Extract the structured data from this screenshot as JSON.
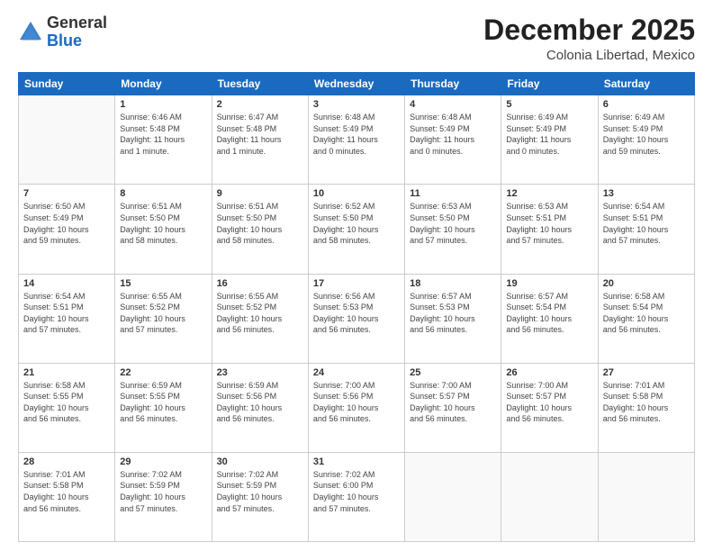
{
  "header": {
    "logo_general": "General",
    "logo_blue": "Blue",
    "month_title": "December 2025",
    "subtitle": "Colonia Libertad, Mexico"
  },
  "weekdays": [
    "Sunday",
    "Monday",
    "Tuesday",
    "Wednesday",
    "Thursday",
    "Friday",
    "Saturday"
  ],
  "weeks": [
    [
      {
        "day": "",
        "info": ""
      },
      {
        "day": "1",
        "info": "Sunrise: 6:46 AM\nSunset: 5:48 PM\nDaylight: 11 hours\nand 1 minute."
      },
      {
        "day": "2",
        "info": "Sunrise: 6:47 AM\nSunset: 5:48 PM\nDaylight: 11 hours\nand 1 minute."
      },
      {
        "day": "3",
        "info": "Sunrise: 6:48 AM\nSunset: 5:49 PM\nDaylight: 11 hours\nand 0 minutes."
      },
      {
        "day": "4",
        "info": "Sunrise: 6:48 AM\nSunset: 5:49 PM\nDaylight: 11 hours\nand 0 minutes."
      },
      {
        "day": "5",
        "info": "Sunrise: 6:49 AM\nSunset: 5:49 PM\nDaylight: 11 hours\nand 0 minutes."
      },
      {
        "day": "6",
        "info": "Sunrise: 6:49 AM\nSunset: 5:49 PM\nDaylight: 10 hours\nand 59 minutes."
      }
    ],
    [
      {
        "day": "7",
        "info": "Sunrise: 6:50 AM\nSunset: 5:49 PM\nDaylight: 10 hours\nand 59 minutes."
      },
      {
        "day": "8",
        "info": "Sunrise: 6:51 AM\nSunset: 5:50 PM\nDaylight: 10 hours\nand 58 minutes."
      },
      {
        "day": "9",
        "info": "Sunrise: 6:51 AM\nSunset: 5:50 PM\nDaylight: 10 hours\nand 58 minutes."
      },
      {
        "day": "10",
        "info": "Sunrise: 6:52 AM\nSunset: 5:50 PM\nDaylight: 10 hours\nand 58 minutes."
      },
      {
        "day": "11",
        "info": "Sunrise: 6:53 AM\nSunset: 5:50 PM\nDaylight: 10 hours\nand 57 minutes."
      },
      {
        "day": "12",
        "info": "Sunrise: 6:53 AM\nSunset: 5:51 PM\nDaylight: 10 hours\nand 57 minutes."
      },
      {
        "day": "13",
        "info": "Sunrise: 6:54 AM\nSunset: 5:51 PM\nDaylight: 10 hours\nand 57 minutes."
      }
    ],
    [
      {
        "day": "14",
        "info": "Sunrise: 6:54 AM\nSunset: 5:51 PM\nDaylight: 10 hours\nand 57 minutes."
      },
      {
        "day": "15",
        "info": "Sunrise: 6:55 AM\nSunset: 5:52 PM\nDaylight: 10 hours\nand 57 minutes."
      },
      {
        "day": "16",
        "info": "Sunrise: 6:55 AM\nSunset: 5:52 PM\nDaylight: 10 hours\nand 56 minutes."
      },
      {
        "day": "17",
        "info": "Sunrise: 6:56 AM\nSunset: 5:53 PM\nDaylight: 10 hours\nand 56 minutes."
      },
      {
        "day": "18",
        "info": "Sunrise: 6:57 AM\nSunset: 5:53 PM\nDaylight: 10 hours\nand 56 minutes."
      },
      {
        "day": "19",
        "info": "Sunrise: 6:57 AM\nSunset: 5:54 PM\nDaylight: 10 hours\nand 56 minutes."
      },
      {
        "day": "20",
        "info": "Sunrise: 6:58 AM\nSunset: 5:54 PM\nDaylight: 10 hours\nand 56 minutes."
      }
    ],
    [
      {
        "day": "21",
        "info": "Sunrise: 6:58 AM\nSunset: 5:55 PM\nDaylight: 10 hours\nand 56 minutes."
      },
      {
        "day": "22",
        "info": "Sunrise: 6:59 AM\nSunset: 5:55 PM\nDaylight: 10 hours\nand 56 minutes."
      },
      {
        "day": "23",
        "info": "Sunrise: 6:59 AM\nSunset: 5:56 PM\nDaylight: 10 hours\nand 56 minutes."
      },
      {
        "day": "24",
        "info": "Sunrise: 7:00 AM\nSunset: 5:56 PM\nDaylight: 10 hours\nand 56 minutes."
      },
      {
        "day": "25",
        "info": "Sunrise: 7:00 AM\nSunset: 5:57 PM\nDaylight: 10 hours\nand 56 minutes."
      },
      {
        "day": "26",
        "info": "Sunrise: 7:00 AM\nSunset: 5:57 PM\nDaylight: 10 hours\nand 56 minutes."
      },
      {
        "day": "27",
        "info": "Sunrise: 7:01 AM\nSunset: 5:58 PM\nDaylight: 10 hours\nand 56 minutes."
      }
    ],
    [
      {
        "day": "28",
        "info": "Sunrise: 7:01 AM\nSunset: 5:58 PM\nDaylight: 10 hours\nand 56 minutes."
      },
      {
        "day": "29",
        "info": "Sunrise: 7:02 AM\nSunset: 5:59 PM\nDaylight: 10 hours\nand 57 minutes."
      },
      {
        "day": "30",
        "info": "Sunrise: 7:02 AM\nSunset: 5:59 PM\nDaylight: 10 hours\nand 57 minutes."
      },
      {
        "day": "31",
        "info": "Sunrise: 7:02 AM\nSunset: 6:00 PM\nDaylight: 10 hours\nand 57 minutes."
      },
      {
        "day": "",
        "info": ""
      },
      {
        "day": "",
        "info": ""
      },
      {
        "day": "",
        "info": ""
      }
    ]
  ]
}
